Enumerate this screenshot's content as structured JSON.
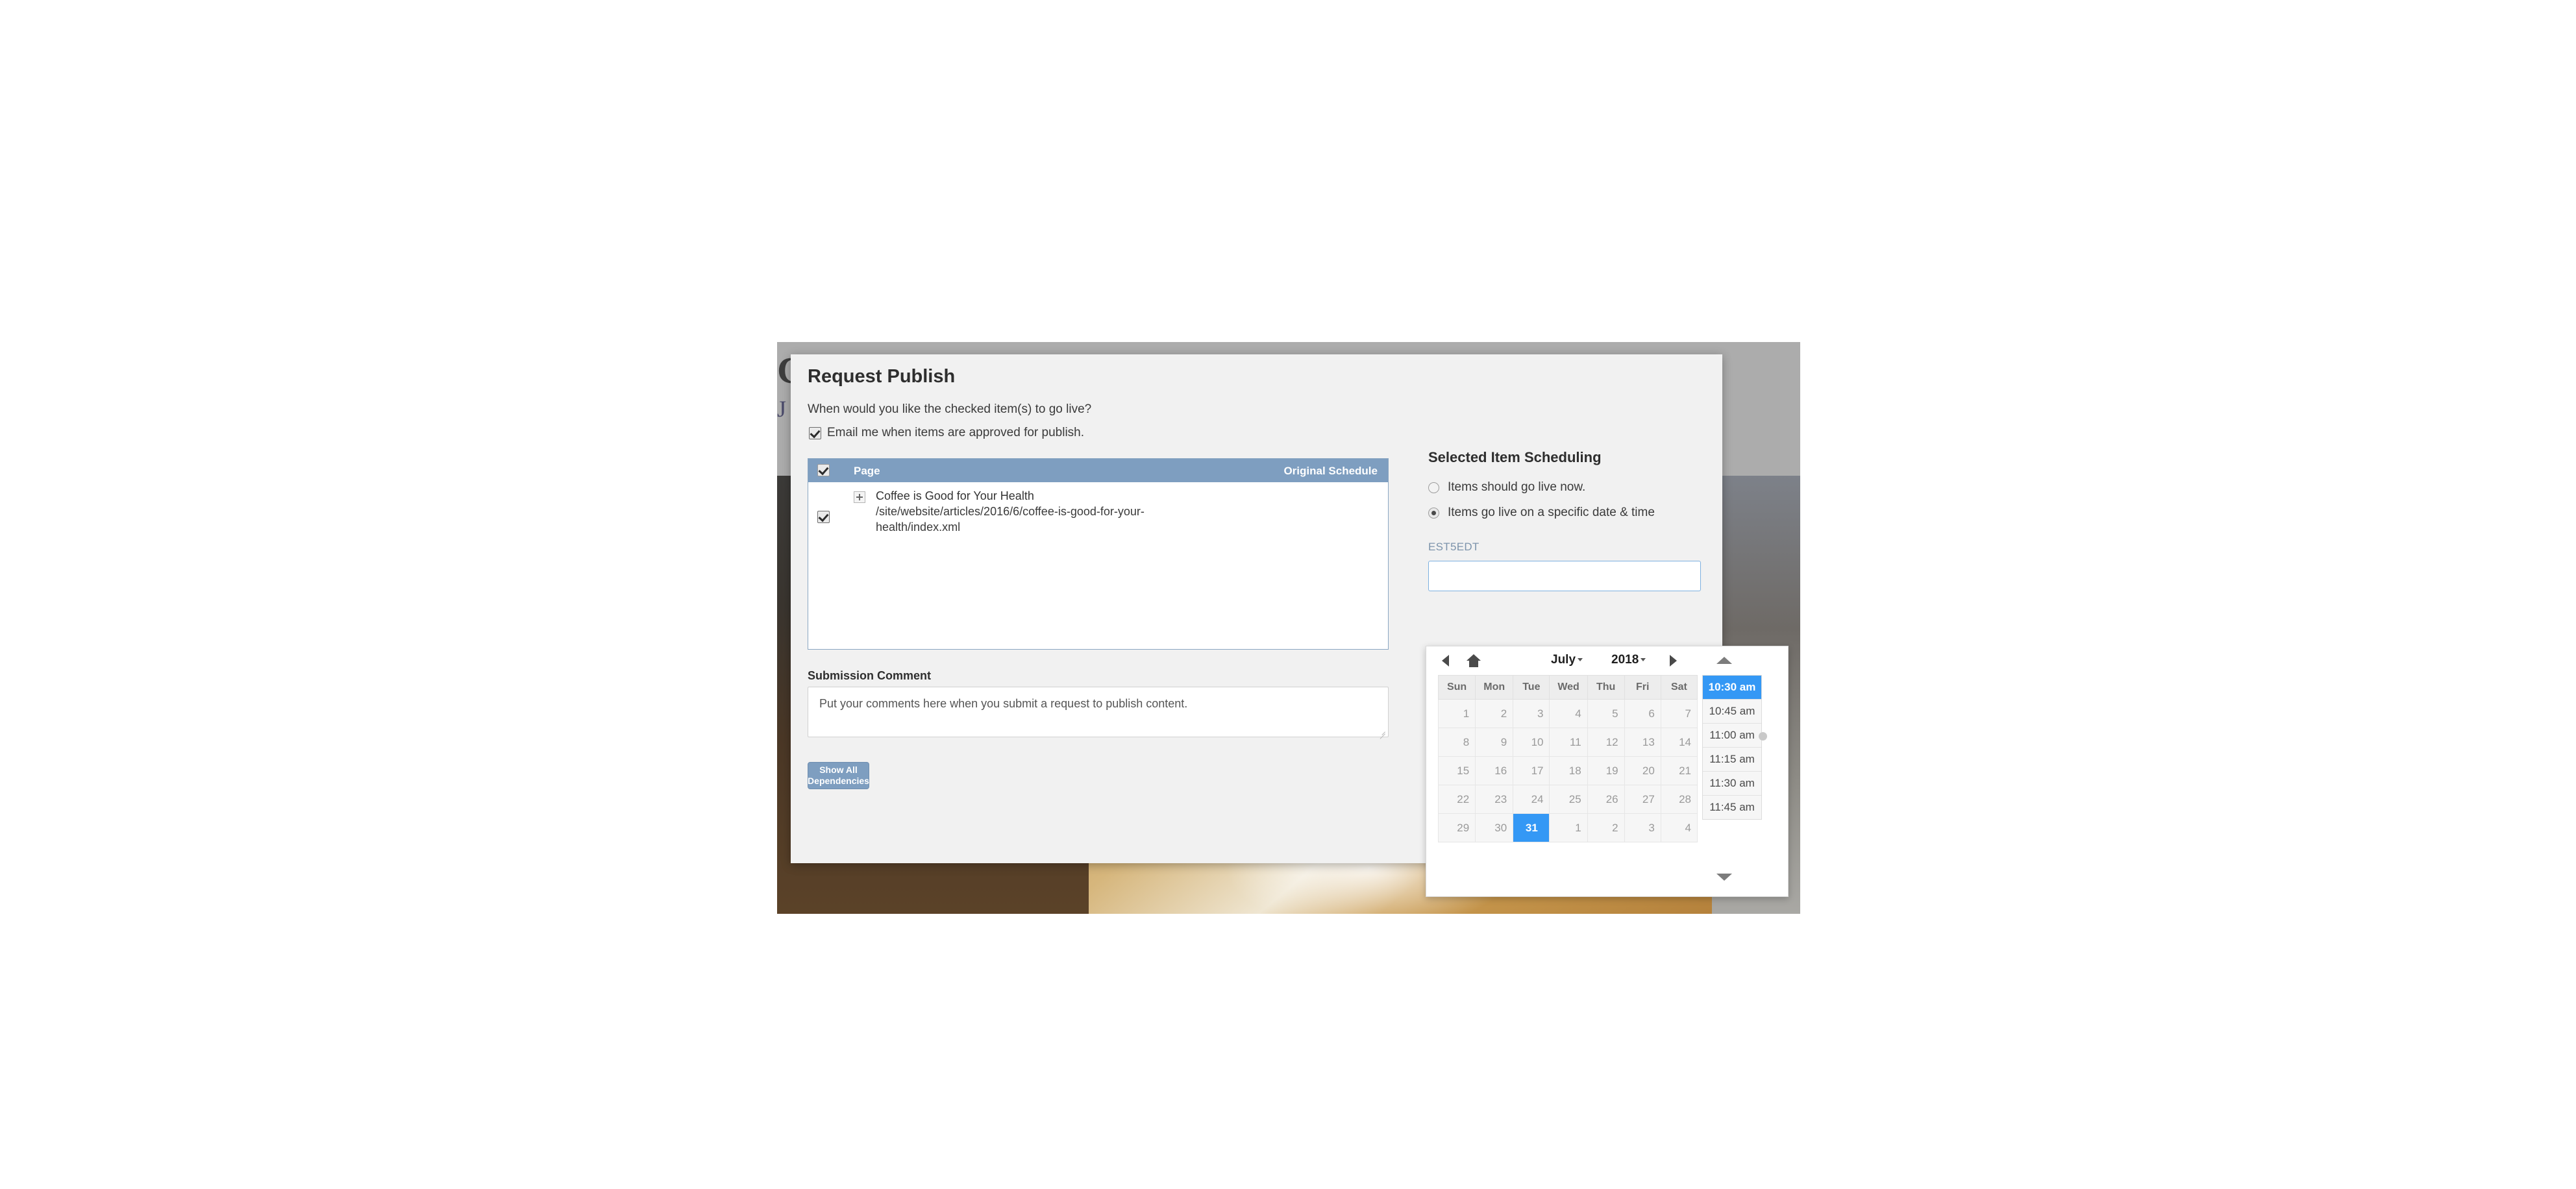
{
  "background_page": {
    "title": "Coffee is Good for Your Health",
    "side_letter": "J",
    "photo_alt": "latte-art-coffee-cup-photo"
  },
  "modal": {
    "title": "Request Publish",
    "question": "When would you like the checked item(s) to go live?",
    "email_checkbox": {
      "label": "Email me when items are approved for publish.",
      "checked": true
    },
    "table": {
      "columns": [
        "Page",
        "Original Schedule"
      ],
      "header_checkbox_checked": true,
      "rows": [
        {
          "checked": true,
          "expander": "+",
          "name": "Coffee is Good for Your Health",
          "path": "/site/website/articles/2016/6/coffee-is-good-for-your-health/index.xml",
          "original_schedule": ""
        }
      ]
    },
    "submission_comment": {
      "label": "Submission Comment",
      "placeholder": "Put your comments here when you submit a request to publish content.",
      "value": ""
    },
    "dependencies_button": "Show All Dependencies"
  },
  "scheduling": {
    "title": "Selected Item Scheduling",
    "options": [
      {
        "label": "Items should go live now.",
        "selected": false
      },
      {
        "label": "Items go live on a specific date & time",
        "selected": true
      }
    ],
    "timezone": "EST5EDT",
    "date_input_value": "",
    "date_input_placeholder": ""
  },
  "datepicker": {
    "month": "July",
    "year": "2018",
    "prev_icon": "caret-left-icon",
    "next_icon": "caret-right-icon",
    "home_icon": "home-icon",
    "scroll_up_icon": "caret-up-icon",
    "scroll_down_icon": "caret-down-icon",
    "weekdays": [
      "Sun",
      "Mon",
      "Tue",
      "Wed",
      "Thu",
      "Fri",
      "Sat"
    ],
    "weeks": [
      [
        {
          "d": "1"
        },
        {
          "d": "2"
        },
        {
          "d": "3"
        },
        {
          "d": "4"
        },
        {
          "d": "5"
        },
        {
          "d": "6"
        },
        {
          "d": "7"
        }
      ],
      [
        {
          "d": "8"
        },
        {
          "d": "9"
        },
        {
          "d": "10"
        },
        {
          "d": "11"
        },
        {
          "d": "12"
        },
        {
          "d": "13"
        },
        {
          "d": "14"
        }
      ],
      [
        {
          "d": "15"
        },
        {
          "d": "16"
        },
        {
          "d": "17"
        },
        {
          "d": "18"
        },
        {
          "d": "19"
        },
        {
          "d": "20"
        },
        {
          "d": "21"
        }
      ],
      [
        {
          "d": "22"
        },
        {
          "d": "23"
        },
        {
          "d": "24"
        },
        {
          "d": "25"
        },
        {
          "d": "26"
        },
        {
          "d": "27"
        },
        {
          "d": "28"
        }
      ],
      [
        {
          "d": "29"
        },
        {
          "d": "30"
        },
        {
          "d": "31",
          "sel": true
        },
        {
          "d": "1"
        },
        {
          "d": "2"
        },
        {
          "d": "3"
        },
        {
          "d": "4"
        }
      ]
    ],
    "selected_day": "31",
    "times": [
      {
        "t": "10:30 am",
        "sel": true
      },
      {
        "t": "10:45 am",
        "sel": false
      },
      {
        "t": "11:00 am",
        "sel": false
      },
      {
        "t": "11:15 am",
        "sel": false
      },
      {
        "t": "11:30 am",
        "sel": false
      },
      {
        "t": "11:45 am",
        "sel": false
      }
    ]
  },
  "colors": {
    "accent_blue": "#3498f5",
    "header_blue": "#7e9ec0",
    "modal_bg": "#f1f1f1",
    "timezone_text": "#7c93ab"
  }
}
